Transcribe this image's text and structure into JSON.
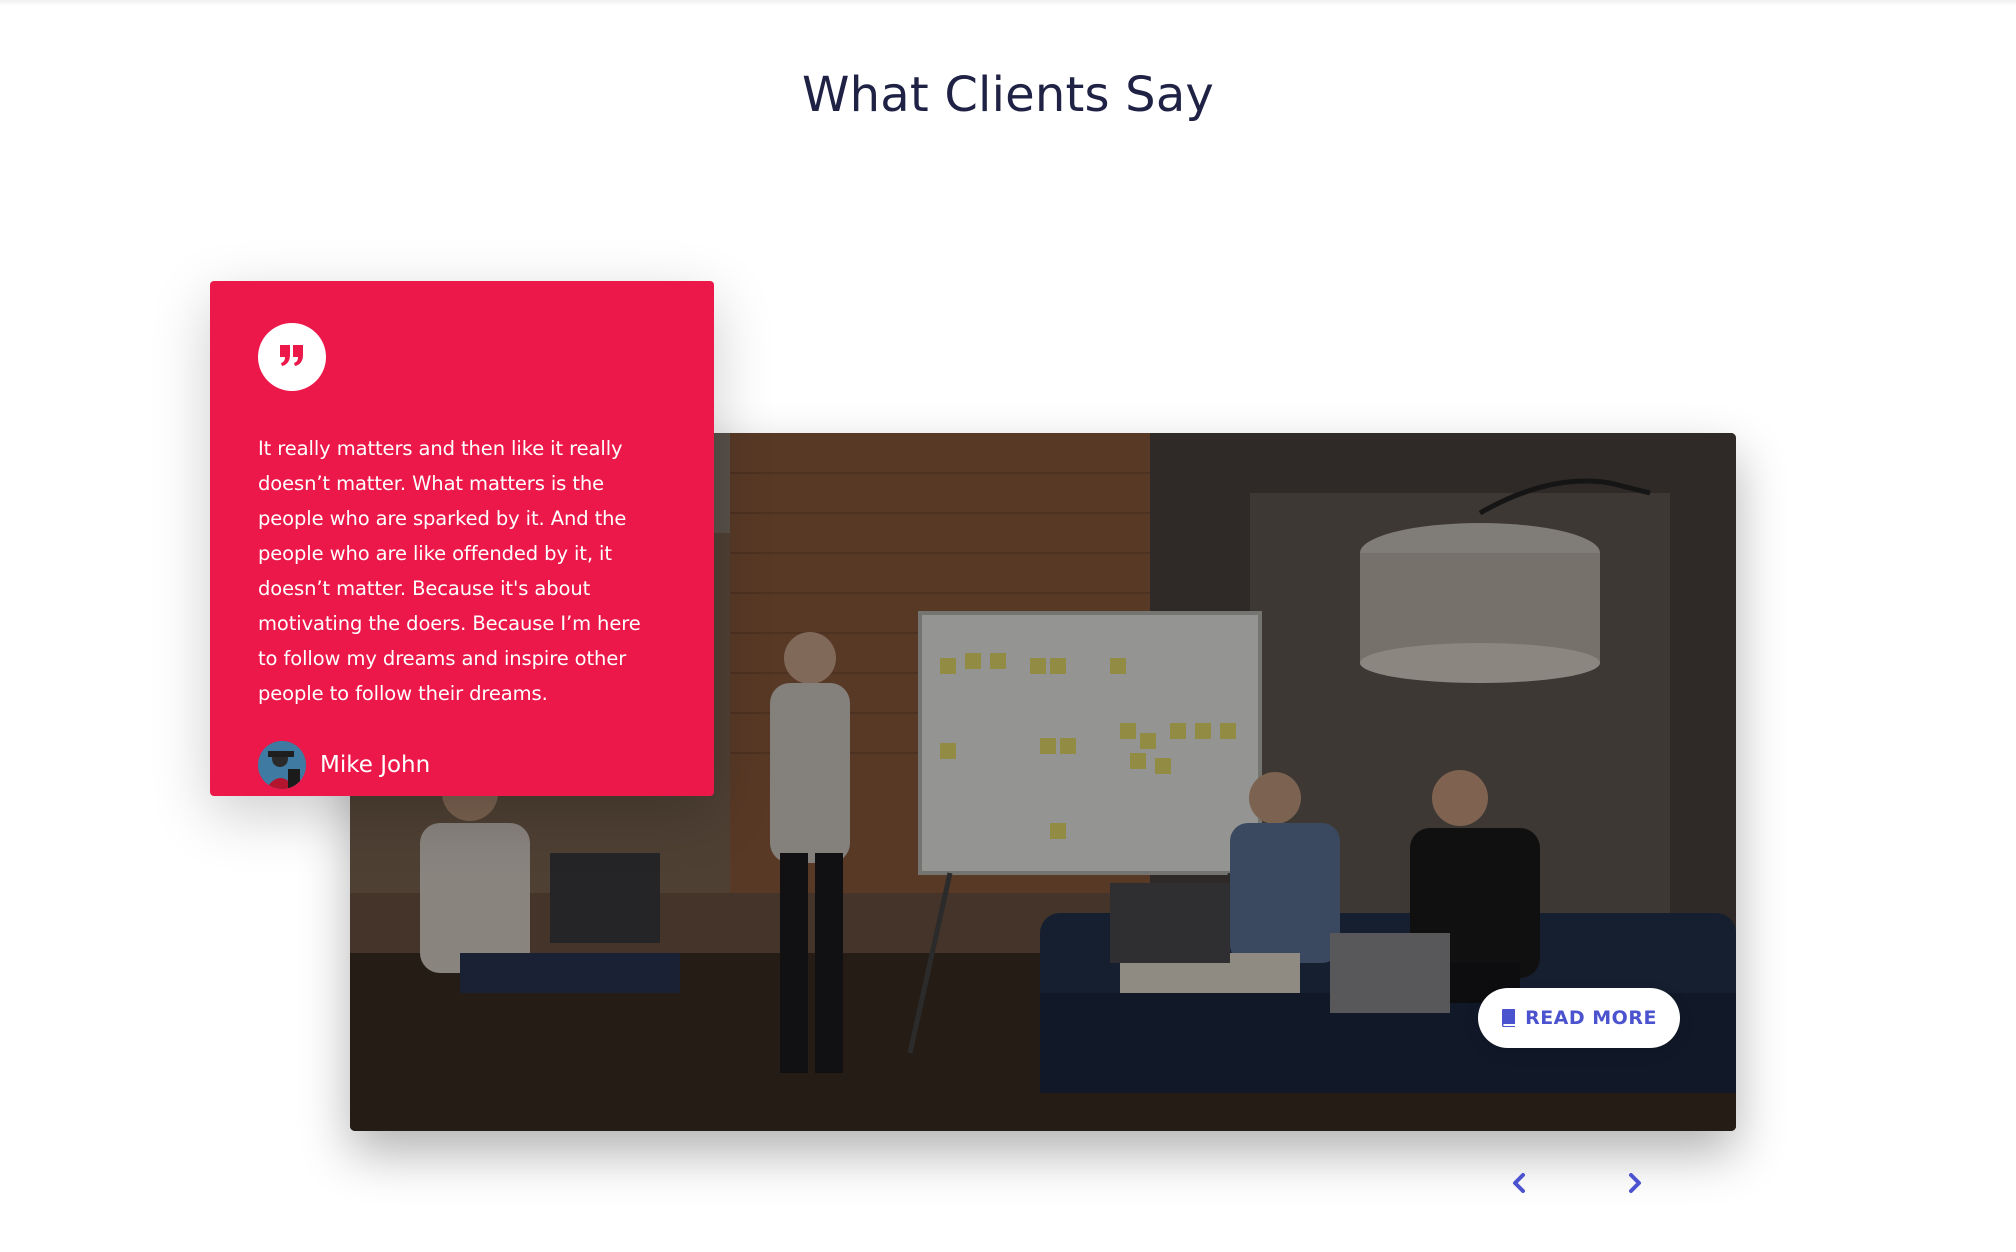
{
  "section": {
    "title": "What Clients Say"
  },
  "testimonial": {
    "quote_icon": "quote-right-icon",
    "text": "It really matters and then like it really doesn’t matter. What matters is the people who are sparked by it. And the people who are like offended by it, it doesn’t matter. Because it's about motivating the doers. Because I’m here to follow my dreams and inspire other people to follow their dreams.",
    "author_name": "Mike John",
    "card_color": "#ec184a"
  },
  "image": {
    "description_icon": "team-meeting-photo"
  },
  "read_more": {
    "label": "READ MORE",
    "icon": "book-icon",
    "color": "#4c53cf"
  },
  "carousel": {
    "prev_icon": "chevron-left-icon",
    "next_icon": "chevron-right-icon",
    "arrow_color": "#4c53cf"
  }
}
